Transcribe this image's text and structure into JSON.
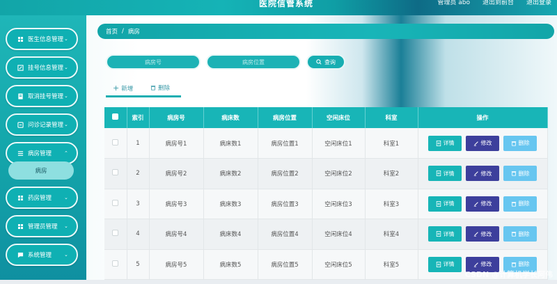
{
  "header": {
    "title": "医院信管系统",
    "links": [
      "管理员 abo",
      "退出到前台",
      "退出登录"
    ]
  },
  "sidebar": {
    "items": [
      {
        "label": "医生信息管理",
        "icon": "grid-icon"
      },
      {
        "label": "挂号信息管理",
        "icon": "edit-icon"
      },
      {
        "label": "取消挂号管理",
        "icon": "document-icon"
      },
      {
        "label": "问诊记录管理",
        "icon": "record-icon"
      },
      {
        "label": "病房管理",
        "icon": "list-icon"
      },
      {
        "label": "药房管理",
        "icon": "grid-icon"
      },
      {
        "label": "管理员管理",
        "icon": "grid-icon"
      },
      {
        "label": "系统管理",
        "icon": "chat-icon"
      }
    ],
    "active_sub": "病房"
  },
  "breadcrumb": {
    "home": "首页",
    "separator": "/",
    "current": "病房"
  },
  "search": {
    "ward_no_placeholder": "病房号",
    "ward_location_placeholder": "病房位置",
    "button": "查询"
  },
  "actions": {
    "add": "新增",
    "delete": "删除"
  },
  "table": {
    "headers": [
      "索引",
      "病房号",
      "病床数",
      "病房位置",
      "空闲床位",
      "科室",
      "操作"
    ],
    "rows": [
      [
        "1",
        "病房号1",
        "病床数1",
        "病房位置1",
        "空闲床位1",
        "科室1"
      ],
      [
        "2",
        "病房号2",
        "病床数2",
        "病房位置2",
        "空闲床位2",
        "科室2"
      ],
      [
        "3",
        "病房号3",
        "病床数3",
        "病房位置3",
        "空闲床位3",
        "科室3"
      ],
      [
        "4",
        "病房号4",
        "病床数4",
        "病房位置4",
        "空闲床位4",
        "科室4"
      ],
      [
        "5",
        "病房号5",
        "病床数5",
        "病房位置5",
        "空闲床位5",
        "科室5"
      ]
    ],
    "op_labels": {
      "detail": "详情",
      "edit": "修改",
      "delete": "删除"
    }
  },
  "watermark": "CSDN @计算机学长阿伟"
}
